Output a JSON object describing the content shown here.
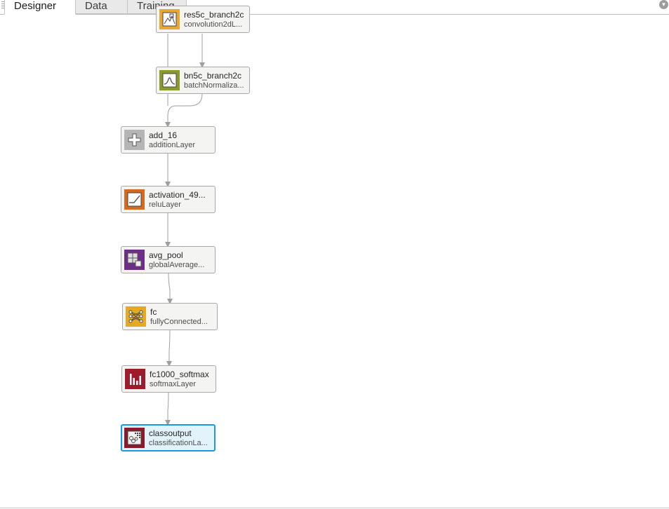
{
  "tabs": [
    {
      "label": "Designer",
      "active": true
    },
    {
      "label": "Data",
      "active": false
    },
    {
      "label": "Training",
      "active": false
    }
  ],
  "layers": [
    {
      "name": "res5c_branch2c",
      "type": "convolution2dL...",
      "icon": "convolution-icon",
      "color": "#e7a933"
    },
    {
      "name": "bn5c_branch2c",
      "type": "batchNormaliza...",
      "icon": "batch-normalization-icon",
      "color": "#8c9a2b"
    },
    {
      "name": "add_16",
      "type": "additionLayer",
      "icon": "addition-icon",
      "color": "#b5b5b5"
    },
    {
      "name": "activation_49...",
      "type": "reluLayer",
      "icon": "relu-icon",
      "color": "#d5691f"
    },
    {
      "name": "avg_pool",
      "type": "globalAverage...",
      "icon": "pooling-icon",
      "color": "#6e2d87"
    },
    {
      "name": "fc",
      "type": "fullyConnected...",
      "icon": "fully-connected-icon",
      "color": "#e6a922"
    },
    {
      "name": "fc1000_softmax",
      "type": "softmaxLayer",
      "icon": "softmax-icon",
      "color": "#9d1c2c"
    },
    {
      "name": "classoutput",
      "type": "classificationLa...",
      "icon": "classification-output-icon",
      "color": "#8c1a2a",
      "selected": true
    }
  ],
  "colors": {
    "accent": "#1a98e0",
    "wire": "#9e9e9e"
  }
}
